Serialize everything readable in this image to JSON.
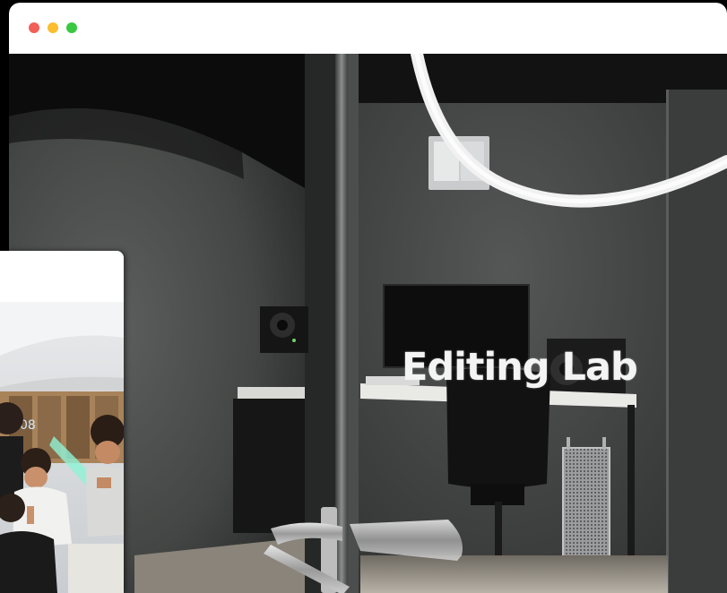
{
  "window": {
    "controls": [
      {
        "name": "close",
        "color": "#f25f58"
      },
      {
        "name": "minimize",
        "color": "#fbbe2f"
      },
      {
        "name": "maximize",
        "color": "#3ac840"
      }
    ]
  },
  "photo": {
    "sign_text": "Editing Lab"
  },
  "colors": {
    "titlebar": "#ffffff",
    "wall": "#4a4c4b",
    "ceiling": "#0b0b0b"
  }
}
